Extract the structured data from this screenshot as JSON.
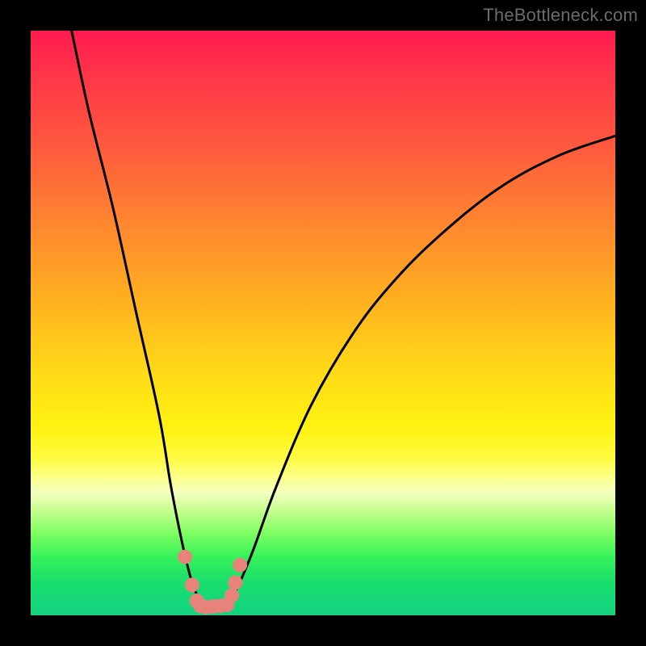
{
  "watermark": "TheBottleneck.com",
  "colors": {
    "frame": "#000000",
    "curve": "#000000",
    "marker": "#e8837c",
    "gradient_stops": [
      "#ff1a4f",
      "#ff3648",
      "#ff5a3d",
      "#ff8a2e",
      "#ffb020",
      "#ffd917",
      "#fff312",
      "#fffb40",
      "#fdff80",
      "#f4ffc0",
      "#c8ff90",
      "#7dff62",
      "#36f25a",
      "#1be06a",
      "#17d878",
      "#14d37e"
    ]
  },
  "chart_data": {
    "type": "line",
    "title": "",
    "xlabel": "",
    "ylabel": "",
    "xlim": [
      0,
      100
    ],
    "ylim": [
      0,
      100
    ],
    "grid": false,
    "series": [
      {
        "name": "bottleneck-curve",
        "x": [
          7,
          10,
          14,
          18,
          22,
          24,
          26,
          27.5,
          29,
          30,
          31,
          33.5,
          35,
          38,
          42,
          48,
          55,
          62,
          70,
          80,
          90,
          100
        ],
        "y": [
          100,
          86,
          70,
          52,
          34,
          22,
          12,
          6,
          2.3,
          1.4,
          1.6,
          1.8,
          4,
          11,
          22,
          36,
          48,
          57,
          65,
          73,
          78.5,
          82
        ]
      }
    ],
    "markers": {
      "name": "highlight-dots",
      "points": [
        {
          "x": 26.4,
          "y": 10.0
        },
        {
          "x": 27.6,
          "y": 5.2
        },
        {
          "x": 28.4,
          "y": 2.5
        },
        {
          "x": 29.0,
          "y": 1.6
        },
        {
          "x": 30.0,
          "y": 1.4
        },
        {
          "x": 31.2,
          "y": 1.5
        },
        {
          "x": 32.4,
          "y": 1.6
        },
        {
          "x": 33.6,
          "y": 1.8
        },
        {
          "x": 34.4,
          "y": 3.4
        },
        {
          "x": 35.0,
          "y": 5.6
        },
        {
          "x": 35.8,
          "y": 8.6
        }
      ]
    }
  }
}
